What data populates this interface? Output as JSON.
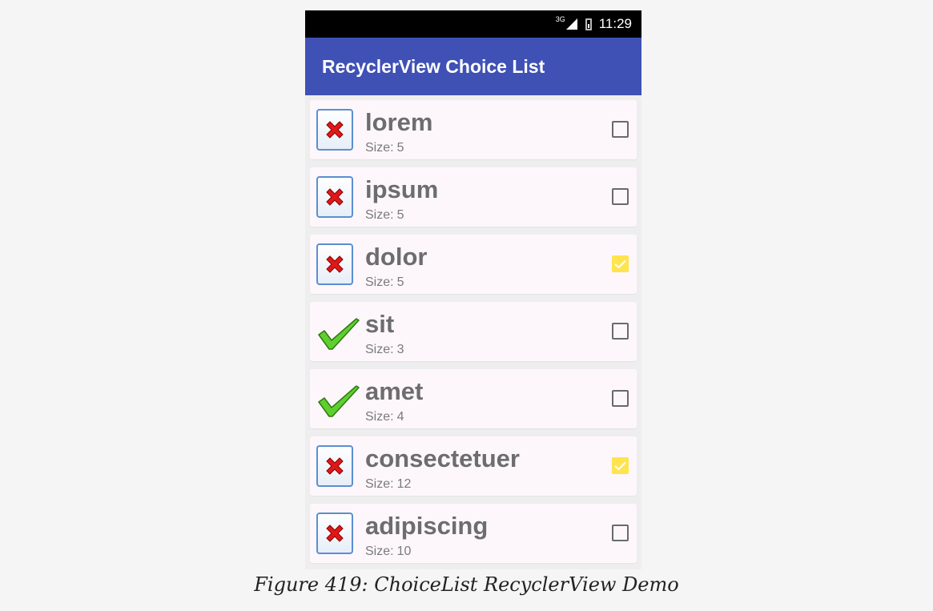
{
  "status_bar": {
    "network": "3G",
    "time": "11:29"
  },
  "app_bar": {
    "title": "RecyclerView Choice List"
  },
  "size_label": "Size:",
  "items": [
    {
      "title": "lorem",
      "size": "5",
      "icon": "red-x-icon",
      "checked": false
    },
    {
      "title": "ipsum",
      "size": "5",
      "icon": "red-x-icon",
      "checked": false
    },
    {
      "title": "dolor",
      "size": "5",
      "icon": "red-x-icon",
      "checked": true
    },
    {
      "title": "sit",
      "size": "3",
      "icon": "green-checkmark-icon",
      "checked": false
    },
    {
      "title": "amet",
      "size": "4",
      "icon": "green-checkmark-icon",
      "checked": false
    },
    {
      "title": "consectetuer",
      "size": "12",
      "icon": "red-x-icon",
      "checked": true
    },
    {
      "title": "adipiscing",
      "size": "10",
      "icon": "red-x-icon",
      "checked": false
    }
  ],
  "caption": "Figure 419: ChoiceList RecyclerView Demo",
  "colors": {
    "app_bar": "#3f51b5",
    "checked_box": "#ffe44d",
    "row_background": "#fdf7fc"
  }
}
